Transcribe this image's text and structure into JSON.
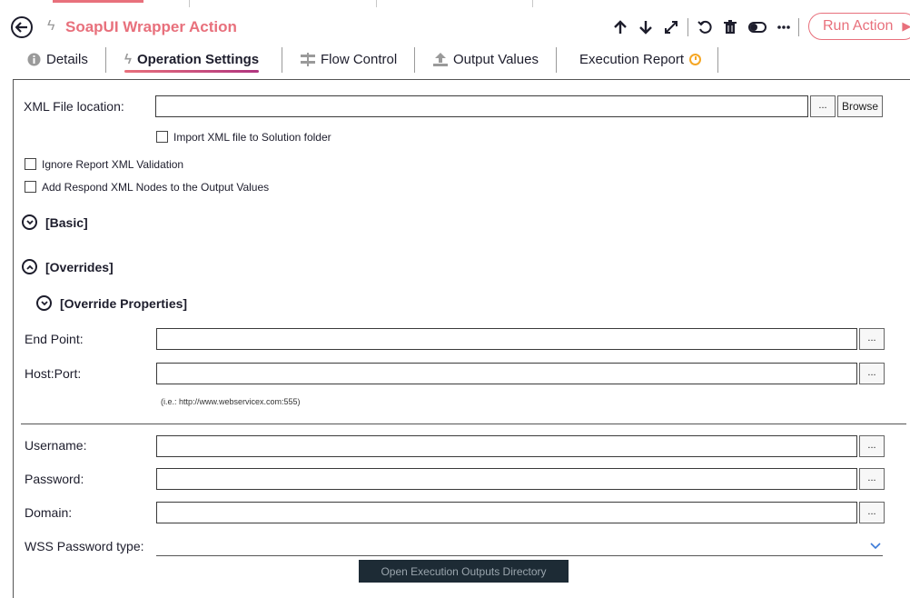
{
  "header": {
    "title": "SoapUI Wrapper Action",
    "run_label": "Run Action"
  },
  "tabs": [
    {
      "label": "Details",
      "icon": "info-icon"
    },
    {
      "label": "Operation Settings",
      "icon": "bolt-icon"
    },
    {
      "label": "Flow Control",
      "icon": "flow-icon"
    },
    {
      "label": "Output Values",
      "icon": "upload-icon"
    },
    {
      "label": "Execution Report",
      "icon": "clock-icon"
    }
  ],
  "form": {
    "xml_file_label": "XML File location:",
    "xml_file_value": "",
    "dots_label": "...",
    "browse_label": "Browse",
    "import_xml_label": "Import XML file to Solution folder",
    "ignore_report_label": "Ignore Report XML Validation",
    "add_respond_label": "Add Respond XML Nodes to the Output Values",
    "basic_label": "[Basic]",
    "overrides_label": "[Overrides]",
    "override_props_label": "[Override Properties]",
    "endpoint_label": "End Point:",
    "hostport_label": "Host:Port:",
    "hostport_hint": "(i.e.: http://www.webservicex.com:555)",
    "username_label": "Username:",
    "password_label": "Password:",
    "domain_label": "Domain:",
    "wss_label": "WSS Password type:",
    "open_dir_label": "Open Execution Outputs Directory"
  },
  "colors": {
    "accent": "#e8707c",
    "dark": "#1d1d2c",
    "button_dark": "#1d2b35"
  }
}
